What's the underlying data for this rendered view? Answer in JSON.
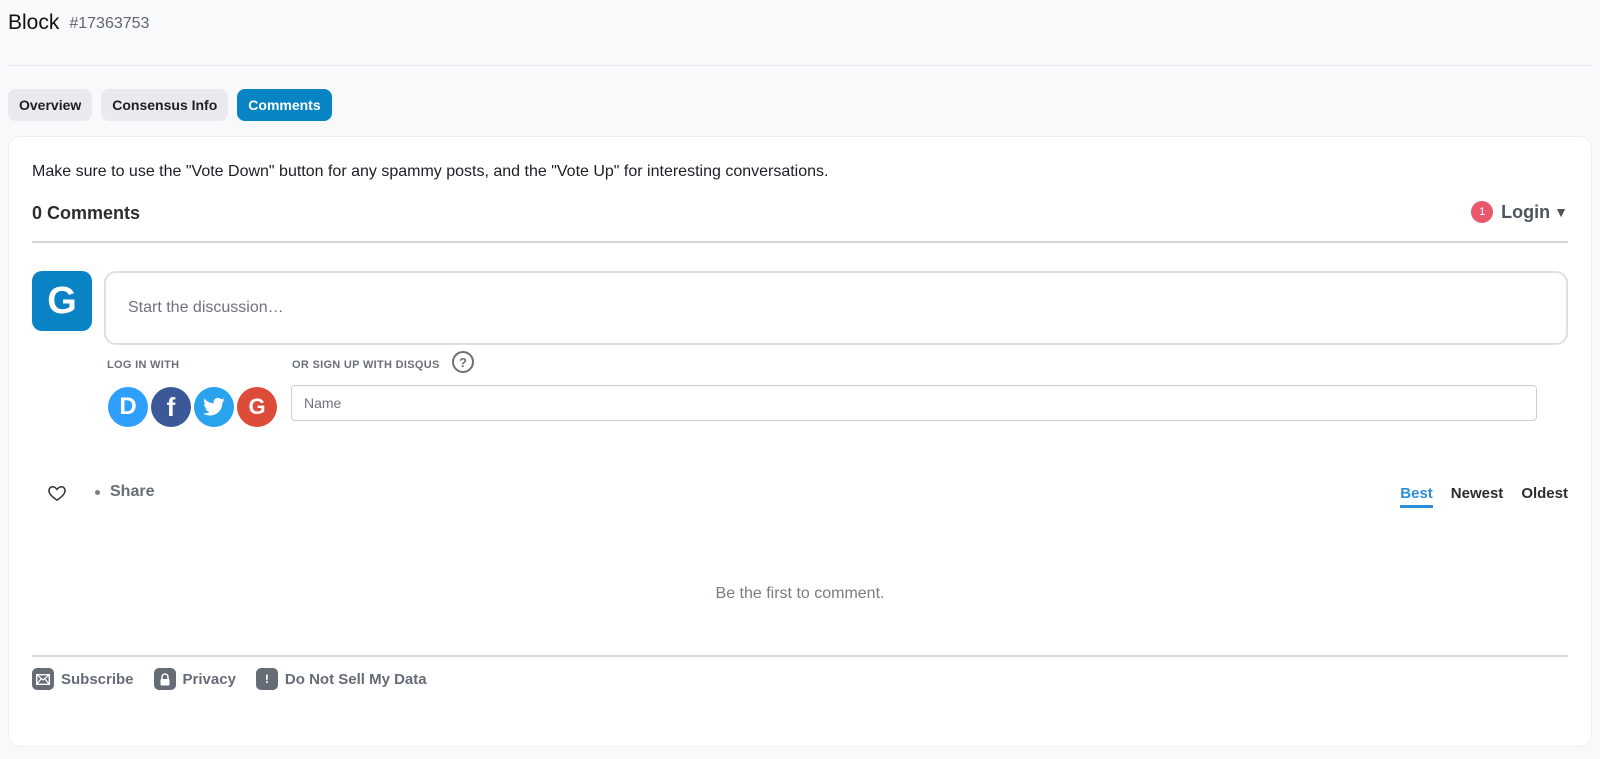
{
  "header": {
    "title": "Block",
    "block_number": "#17363753"
  },
  "tabs": [
    {
      "label": "Overview",
      "active": false
    },
    {
      "label": "Consensus Info",
      "active": false
    },
    {
      "label": "Comments",
      "active": true
    }
  ],
  "comments": {
    "intro": "Make sure to use the \"Vote Down\" button for any spammy posts, and the \"Vote Up\" for interesting conversations.",
    "count_label": "0 Comments",
    "notification_count": "1",
    "login_label": "Login",
    "avatar_letter": "G",
    "composer_placeholder": "Start the discussion…",
    "login_with_label": "LOG IN WITH",
    "signup_label": "OR SIGN UP WITH DISQUS",
    "help_glyph": "?",
    "social_providers": [
      {
        "name": "disqus",
        "glyph": "D",
        "color": "#2e9fff"
      },
      {
        "name": "facebook",
        "glyph": "f",
        "color": "#3b5998"
      },
      {
        "name": "twitter",
        "glyph": "bird",
        "color": "#2aa3ef"
      },
      {
        "name": "google",
        "glyph": "G",
        "color": "#dd4b39"
      }
    ],
    "name_placeholder": "Name",
    "share_label": "Share",
    "sort_options": [
      {
        "label": "Best",
        "active": true
      },
      {
        "label": "Newest",
        "active": false
      },
      {
        "label": "Oldest",
        "active": false
      }
    ],
    "empty_message": "Be the first to comment."
  },
  "footer": {
    "subscribe_label": "Subscribe",
    "privacy_label": "Privacy",
    "do_not_sell_label": "Do Not Sell My Data",
    "do_not_sell_glyph": "!"
  },
  "colors": {
    "accent": "#0784c3",
    "badge": "#e8576b",
    "sort_active": "#2e8dd8"
  }
}
